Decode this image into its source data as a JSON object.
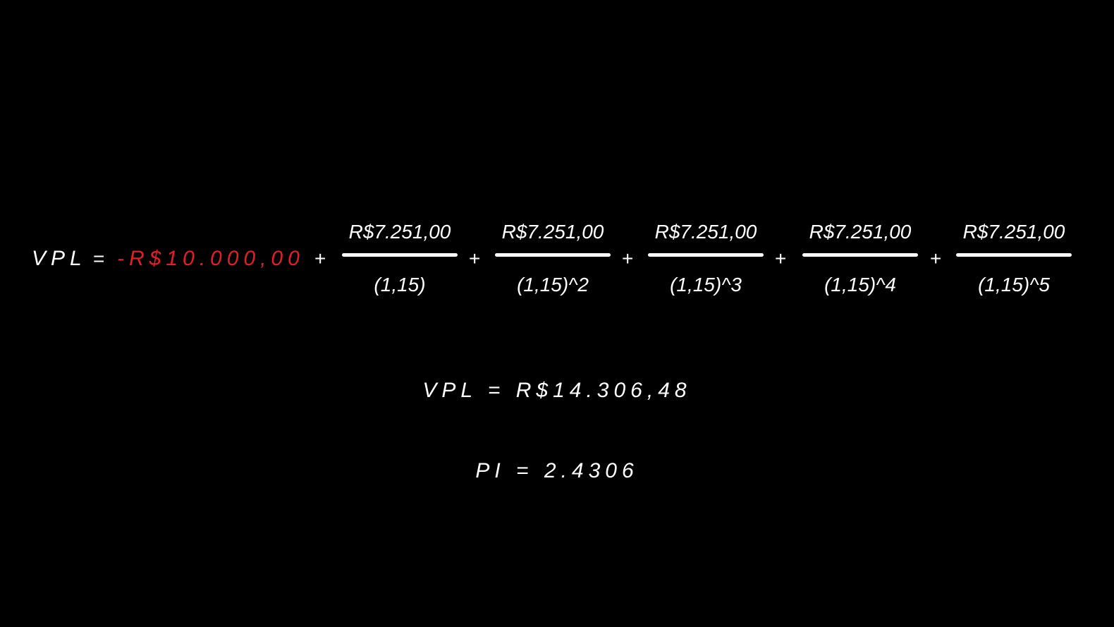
{
  "formula": {
    "lhs": "VPL",
    "equals": "=",
    "initial": "-R$10.000,00",
    "plus": "+",
    "fractions": [
      {
        "numerator": "R$7.251,00",
        "denominator": "(1,15)"
      },
      {
        "numerator": "R$7.251,00",
        "denominator": "(1,15)^2"
      },
      {
        "numerator": "R$7.251,00",
        "denominator": "(1,15)^3"
      },
      {
        "numerator": "R$7.251,00",
        "denominator": "(1,15)^4"
      },
      {
        "numerator": "R$7.251,00",
        "denominator": "(1,15)^5"
      }
    ]
  },
  "results": {
    "vpl": "VPL = R$14.306,48",
    "pi": "PI = 2.4306"
  },
  "colors": {
    "background": "#000000",
    "text": "#ffffff",
    "negative": "#e31e24"
  }
}
